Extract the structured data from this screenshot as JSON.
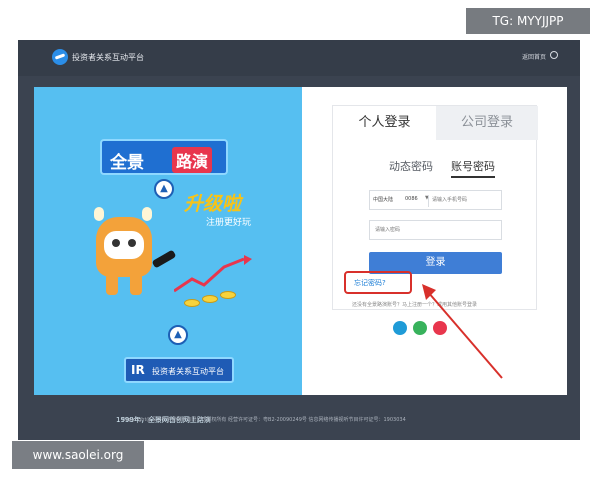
{
  "header": {
    "site_name": "投资者关系互动平台",
    "back_home": "返回首页"
  },
  "promo": {
    "brand_left": "全景",
    "brand_right": "路演",
    "upgrade": "升级啦",
    "upgrade_sub": "注册更好玩",
    "ir_mark": "IR",
    "ir_text": "投资者关系互动平台",
    "slogan": "1999年，全景网首创网上路演"
  },
  "login": {
    "tabs": [
      "个人登录",
      "公司登录"
    ],
    "subtabs": [
      "动态密码",
      "账号密码"
    ],
    "active_subtab_index": 1,
    "country": "中国大陆",
    "country_code": "0086",
    "phone_placeholder": "请输入手机号码",
    "password_placeholder": "请输入密码",
    "submit": "登录",
    "forgot": "忘记密码?",
    "other": "还没有全景路演账号？马上注册一个？或用其他账号登录",
    "social": [
      "qq",
      "wechat",
      "weibo"
    ]
  },
  "footer": {
    "text": "Copyright@深圳市全景网络有限公司版权所有 经营许可证号：粤B2-20090249号 信息网络传播视听节目许可证号：1903034"
  },
  "watermarks": {
    "top": "TG: MYYJJPP",
    "bottom": "www.saolei.org"
  },
  "colors": {
    "accent": "#3f7ed6",
    "annotation": "#d8302b",
    "left_panel": "#56bff1"
  }
}
